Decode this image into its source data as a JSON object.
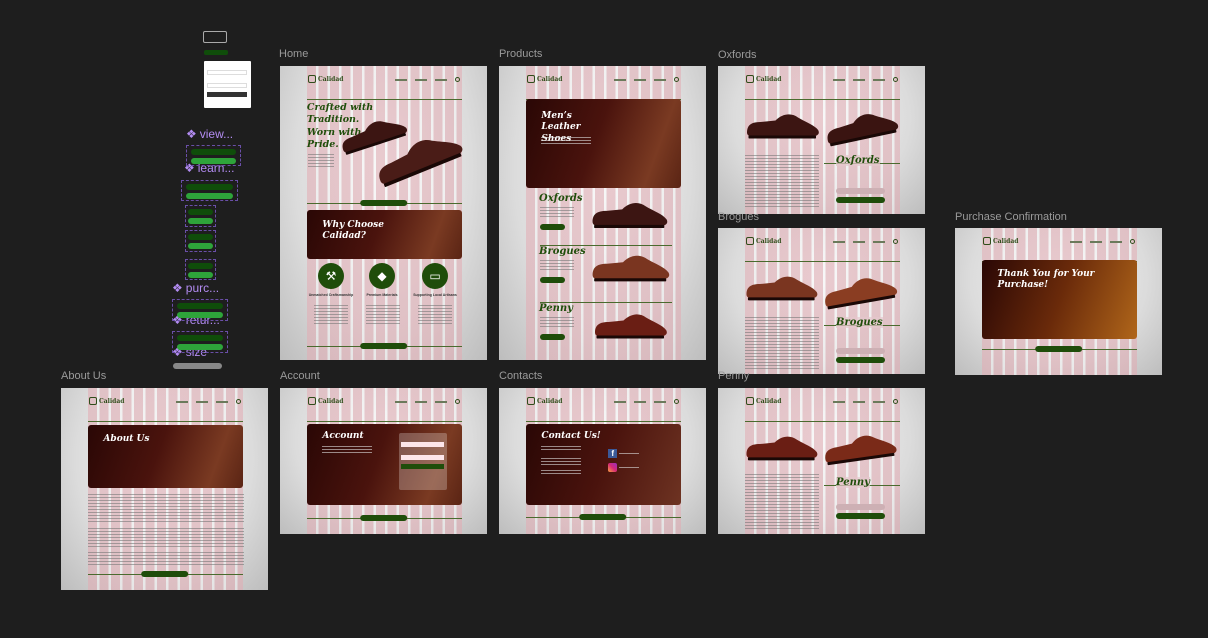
{
  "frames": {
    "home": {
      "label": "Home",
      "hero": "Crafted with Tradition. Worn with Pride.",
      "why": "Why Choose Calidad?",
      "features": [
        "Unmatched Craftsmanship",
        "Premium Materials",
        "Supporting Local Artisans"
      ]
    },
    "products": {
      "label": "Products",
      "hero": "Men’s Leather Shoes",
      "items": [
        "Oxfords",
        "Brogues",
        "Penny"
      ]
    },
    "oxfords": {
      "label": "Oxfords",
      "title": "Oxfords"
    },
    "brogues": {
      "label": "Brogues",
      "title": "Brogues"
    },
    "penny": {
      "label": "Penny",
      "title": "Penny"
    },
    "purchase": {
      "label": "Purchase Confirmation",
      "title": "Thank You for Your Purchase!"
    },
    "about": {
      "label": "About Us",
      "title": "About Us"
    },
    "account": {
      "label": "Account",
      "title": "Account"
    },
    "contacts": {
      "label": "Contacts",
      "title": "Contact Us!"
    }
  },
  "brand": {
    "name": "Calidad",
    "sub": "Leathers"
  },
  "components": [
    "view...",
    "learn...",
    "purc...",
    "retur...",
    "size"
  ],
  "colors": {
    "canvas": "#1e1e1e",
    "brand_green": "#1f4d0a",
    "component_purple": "#b38cf2",
    "pink_grid": "#e2aab2"
  }
}
